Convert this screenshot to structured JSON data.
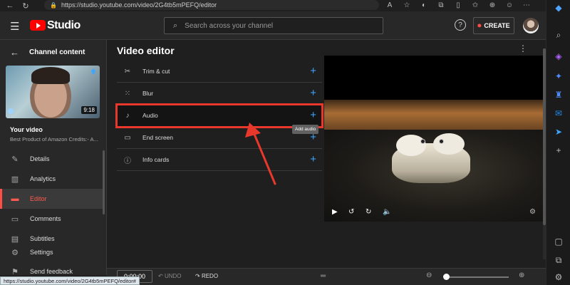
{
  "browser": {
    "url": "https://studio.youtube.com/video/2G4tb5mPEFQ/editor",
    "status_url": "https://studio.youtube.com/video/2G4tb5mPEFQ/editor#"
  },
  "header": {
    "logo_text": "Studio",
    "search_placeholder": "Search across your channel",
    "create_label": "CREATE"
  },
  "sidebar": {
    "back_label": "Channel content",
    "thumbnail_duration": "9:18",
    "your_video_label": "Your video",
    "video_title": "Best Product of Amazon Credits:- A...",
    "items": [
      {
        "label": "Details",
        "icon": "pencil-icon"
      },
      {
        "label": "Analytics",
        "icon": "bar-chart-icon"
      },
      {
        "label": "Editor",
        "icon": "clapper-icon",
        "active": true
      },
      {
        "label": "Comments",
        "icon": "comment-icon"
      },
      {
        "label": "Subtitles",
        "icon": "subtitles-icon"
      }
    ],
    "bottom_items": [
      {
        "label": "Settings",
        "icon": "gear-icon"
      },
      {
        "label": "Send feedback",
        "icon": "feedback-icon"
      }
    ]
  },
  "main": {
    "title": "Video editor",
    "tools": [
      {
        "label": "Trim & cut",
        "icon": "scissors-icon"
      },
      {
        "label": "Blur",
        "icon": "blur-icon"
      },
      {
        "label": "Audio",
        "icon": "music-note-icon",
        "highlighted": true
      },
      {
        "label": "End screen",
        "icon": "end-screen-icon"
      },
      {
        "label": "Info cards",
        "icon": "info-icon"
      }
    ],
    "tooltip": "Add audio"
  },
  "timeline": {
    "time": "0:00:00",
    "undo_label": "UNDO",
    "redo_label": "REDO"
  },
  "colors": {
    "accent_red": "#ff4e45",
    "annotation_red": "#e8382b",
    "blue_plus": "#3ea6ff"
  }
}
